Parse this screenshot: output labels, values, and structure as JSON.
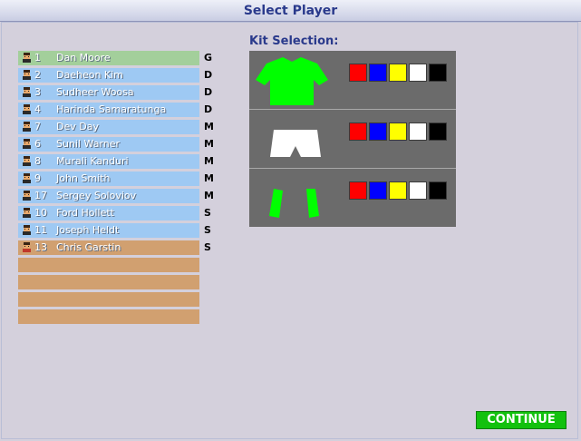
{
  "window": {
    "title": "Select Player"
  },
  "players": [
    {
      "number": "1",
      "name": "Dan Moore",
      "position": "G",
      "style": "green"
    },
    {
      "number": "2",
      "name": "Daeheon Kim",
      "position": "D",
      "style": "blue"
    },
    {
      "number": "3",
      "name": "Sudheer Woosa",
      "position": "D",
      "style": "blue"
    },
    {
      "number": "4",
      "name": "Harinda Samaratunga",
      "position": "D",
      "style": "blue"
    },
    {
      "number": "7",
      "name": "Dev Day",
      "position": "M",
      "style": "blue"
    },
    {
      "number": "6",
      "name": "Sunil Warner",
      "position": "M",
      "style": "blue"
    },
    {
      "number": "8",
      "name": "Murali Kanduri",
      "position": "M",
      "style": "blue"
    },
    {
      "number": "9",
      "name": "John Smith",
      "position": "M",
      "style": "blue"
    },
    {
      "number": "17",
      "name": "Sergey Soloviov",
      "position": "M",
      "style": "blue"
    },
    {
      "number": "10",
      "name": "Ford Hollett",
      "position": "S",
      "style": "blue"
    },
    {
      "number": "11",
      "name": "Joseph Heldt",
      "position": "S",
      "style": "blue"
    },
    {
      "number": "13",
      "name": "Chris Garstin",
      "position": "S",
      "style": "orange"
    }
  ],
  "empty_slot_count": 4,
  "kit": {
    "title": "Kit Selection:",
    "items": [
      {
        "part": "shirt",
        "icon": "shirt-icon",
        "color": "#00ff00"
      },
      {
        "part": "shorts",
        "icon": "shorts-icon",
        "color": "#ffffff"
      },
      {
        "part": "socks",
        "icon": "socks-icon",
        "color": "#00ff00"
      }
    ],
    "swatch_colors": [
      "#ff0000",
      "#0000ff",
      "#ffff00",
      "#ffffff",
      "#000000"
    ]
  },
  "continue_label": "CONTINUE",
  "colors": {
    "title": "#2a3a8c",
    "button": "#12c10e",
    "row_blue": "#9ec9f3",
    "row_green": "#a3cf9b",
    "row_orange": "#d1a070"
  }
}
